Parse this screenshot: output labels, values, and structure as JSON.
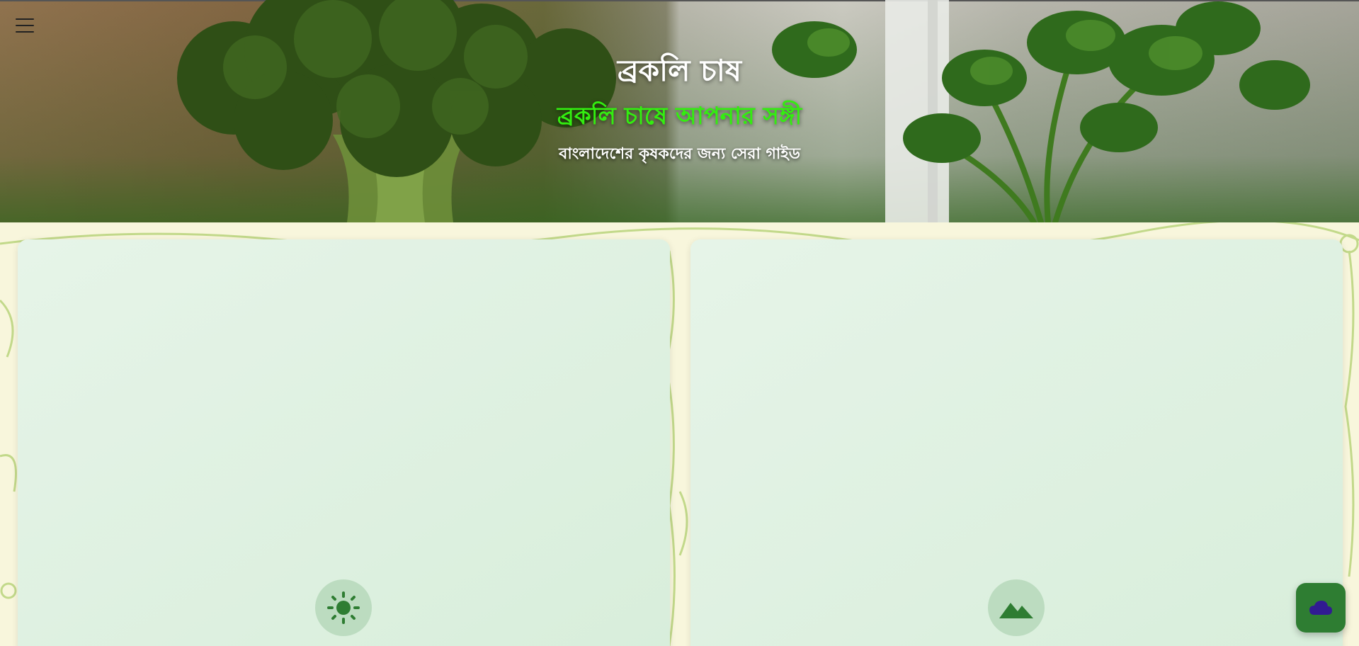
{
  "header": {
    "title": "ব্রকলি চাষ",
    "subtitle": "ব্রকলি চাষে আপনার সঙ্গী",
    "tagline": "বাংলাদেশের কৃষকদের জন্য সেরা গাইড"
  },
  "icons": {
    "menu": "menu-icon",
    "card_left": "sun-icon",
    "card_right": "mountain-icon",
    "fab": "cloud-icon"
  },
  "colors": {
    "subtitle": "#33ee10",
    "card_bg": "#dcefdf",
    "icon_circle": "#bcdcc0",
    "icon_fg": "#2e7d32",
    "fab_bg": "#2e7d32",
    "fab_icon": "#311b92",
    "page_bg": "#f8f6dc"
  }
}
